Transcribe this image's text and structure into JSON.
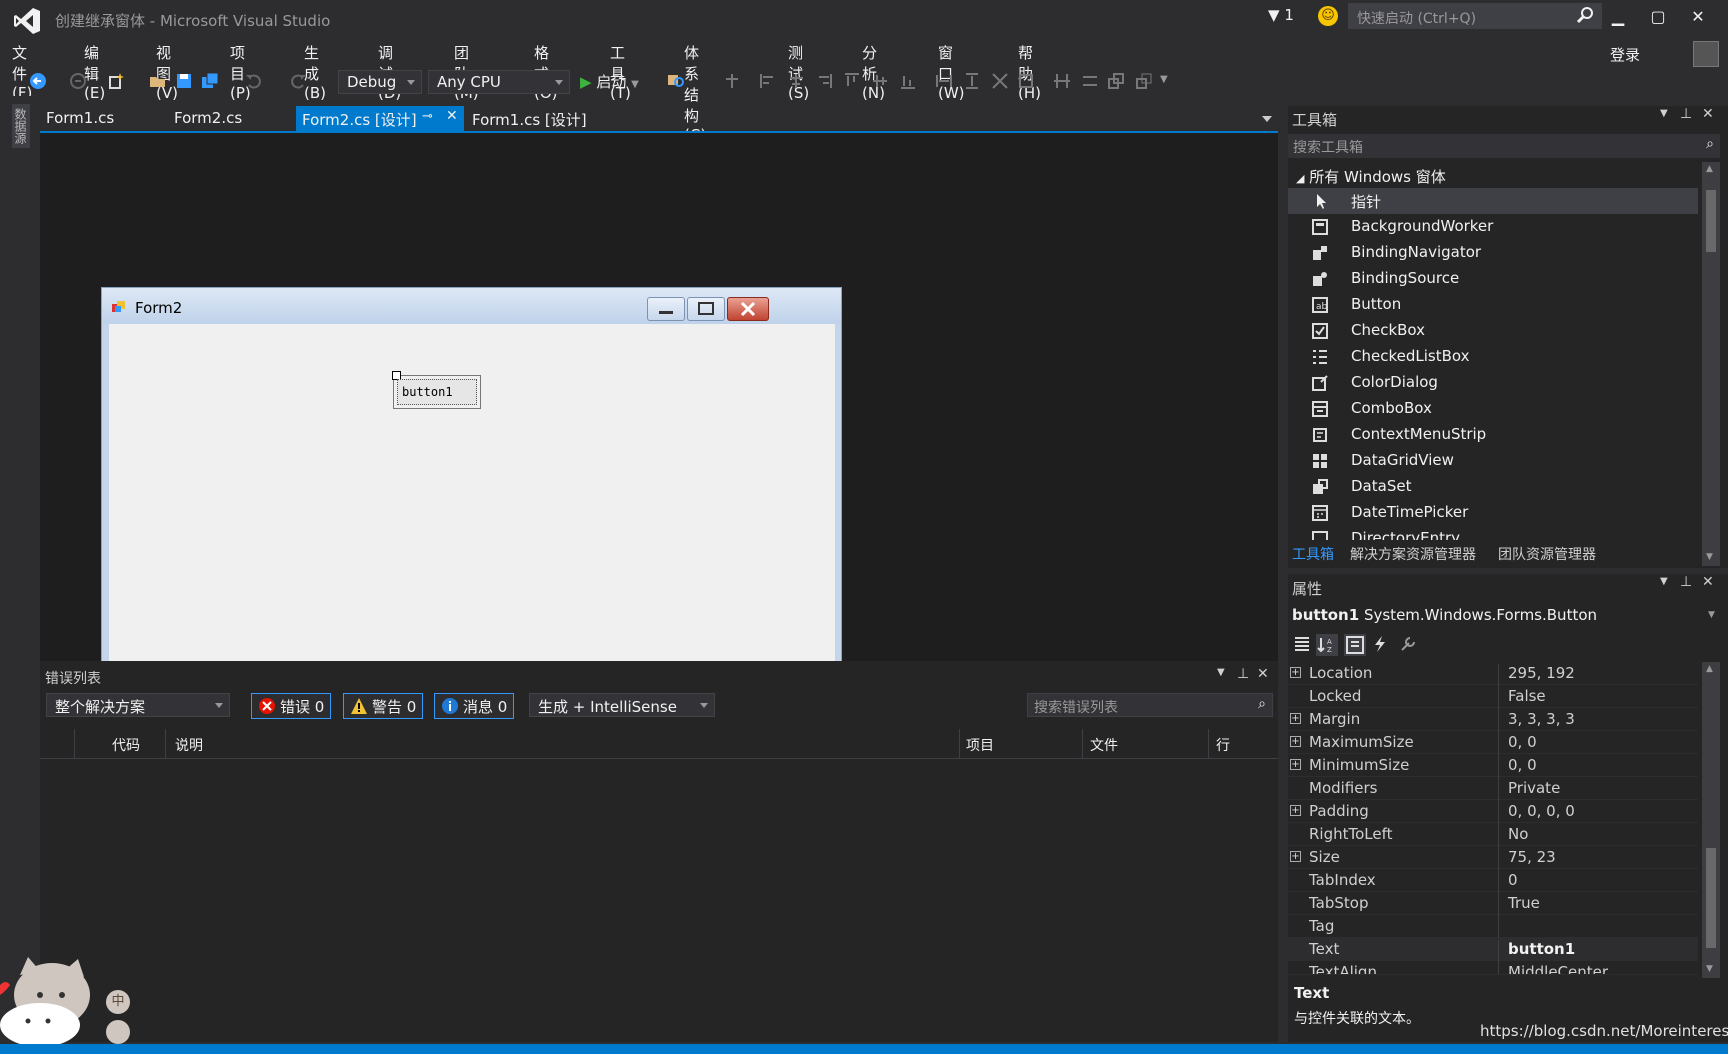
{
  "window": {
    "title": "创建继承窗体 - Microsoft Visual Studio",
    "filter_count": "1",
    "quick_launch_placeholder": "快速启动 (Ctrl+Q)",
    "sign_in": "登录"
  },
  "menu": [
    "文件(F)",
    "编辑(E)",
    "视图(V)",
    "项目(P)",
    "生成(B)",
    "调试(D)",
    "团队(M)",
    "格式(O)",
    "工具(T)",
    "体系结构(C)",
    "测试(S)",
    "分析(N)",
    "窗口(W)",
    "帮助(H)"
  ],
  "toolbar": {
    "config": "Debug",
    "platform": "Any CPU",
    "start": "启动"
  },
  "left_strip": {
    "data_sources": "数据源"
  },
  "doc_tabs": [
    {
      "label": "Form1.cs"
    },
    {
      "label": "Form2.cs"
    },
    {
      "label": "Form2.cs [设计]",
      "active": true
    },
    {
      "label": "Form1.cs [设计]"
    }
  ],
  "designer": {
    "form_title": "Form2",
    "button_text": "button1"
  },
  "error_list": {
    "title": "错误列表",
    "scope": "整个解决方案",
    "errors": "错误 0",
    "warnings": "警告 0",
    "messages": "消息 0",
    "source": "生成 + IntelliSense",
    "search_placeholder": "搜索错误列表",
    "columns": [
      "代码",
      "说明",
      "项目",
      "文件",
      "行"
    ]
  },
  "toolbox": {
    "title": "工具箱",
    "search_placeholder": "搜索工具箱",
    "group": "所有 Windows 窗体",
    "items": [
      {
        "label": "指针",
        "icon": "pointer-icon"
      },
      {
        "label": "BackgroundWorker",
        "icon": "background-worker-icon"
      },
      {
        "label": "BindingNavigator",
        "icon": "binding-navigator-icon"
      },
      {
        "label": "BindingSource",
        "icon": "binding-source-icon"
      },
      {
        "label": "Button",
        "icon": "button-icon"
      },
      {
        "label": "CheckBox",
        "icon": "checkbox-icon"
      },
      {
        "label": "CheckedListBox",
        "icon": "checked-listbox-icon"
      },
      {
        "label": "ColorDialog",
        "icon": "color-dialog-icon"
      },
      {
        "label": "ComboBox",
        "icon": "combobox-icon"
      },
      {
        "label": "ContextMenuStrip",
        "icon": "context-menu-icon"
      },
      {
        "label": "DataGridView",
        "icon": "datagridview-icon"
      },
      {
        "label": "DataSet",
        "icon": "dataset-icon"
      },
      {
        "label": "DateTimePicker",
        "icon": "datetimepicker-icon"
      },
      {
        "label": "DirectoryEntry",
        "icon": "directory-entry-icon"
      }
    ]
  },
  "side_tabs": [
    "工具箱",
    "解决方案资源管理器",
    "团队资源管理器"
  ],
  "properties": {
    "title": "属性",
    "object_name": "button1",
    "object_type": "System.Windows.Forms.Button",
    "rows": [
      {
        "name": "Location",
        "value": "295, 192",
        "expandable": true
      },
      {
        "name": "Locked",
        "value": "False"
      },
      {
        "name": "Margin",
        "value": "3, 3, 3, 3",
        "expandable": true
      },
      {
        "name": "MaximumSize",
        "value": "0, 0",
        "expandable": true
      },
      {
        "name": "MinimumSize",
        "value": "0, 0",
        "expandable": true
      },
      {
        "name": "Modifiers",
        "value": "Private"
      },
      {
        "name": "Padding",
        "value": "0, 0, 0, 0",
        "expandable": true
      },
      {
        "name": "RightToLeft",
        "value": "No"
      },
      {
        "name": "Size",
        "value": "75, 23",
        "expandable": true
      },
      {
        "name": "TabIndex",
        "value": "0"
      },
      {
        "name": "TabStop",
        "value": "True"
      },
      {
        "name": "Tag",
        "value": ""
      },
      {
        "name": "Text",
        "value": "button1",
        "bold": true
      },
      {
        "name": "TextAlign",
        "value": "MiddleCenter"
      }
    ],
    "desc_title": "Text",
    "desc_text": "与控件关联的文本。"
  },
  "watermark": "https://blog.csdn.net/Moreinterest",
  "ime": {
    "lang": "中"
  },
  "colors": {
    "accent": "#007acc",
    "background": "#2d2d30",
    "panel": "#252526",
    "editor": "#1e1e1e"
  }
}
